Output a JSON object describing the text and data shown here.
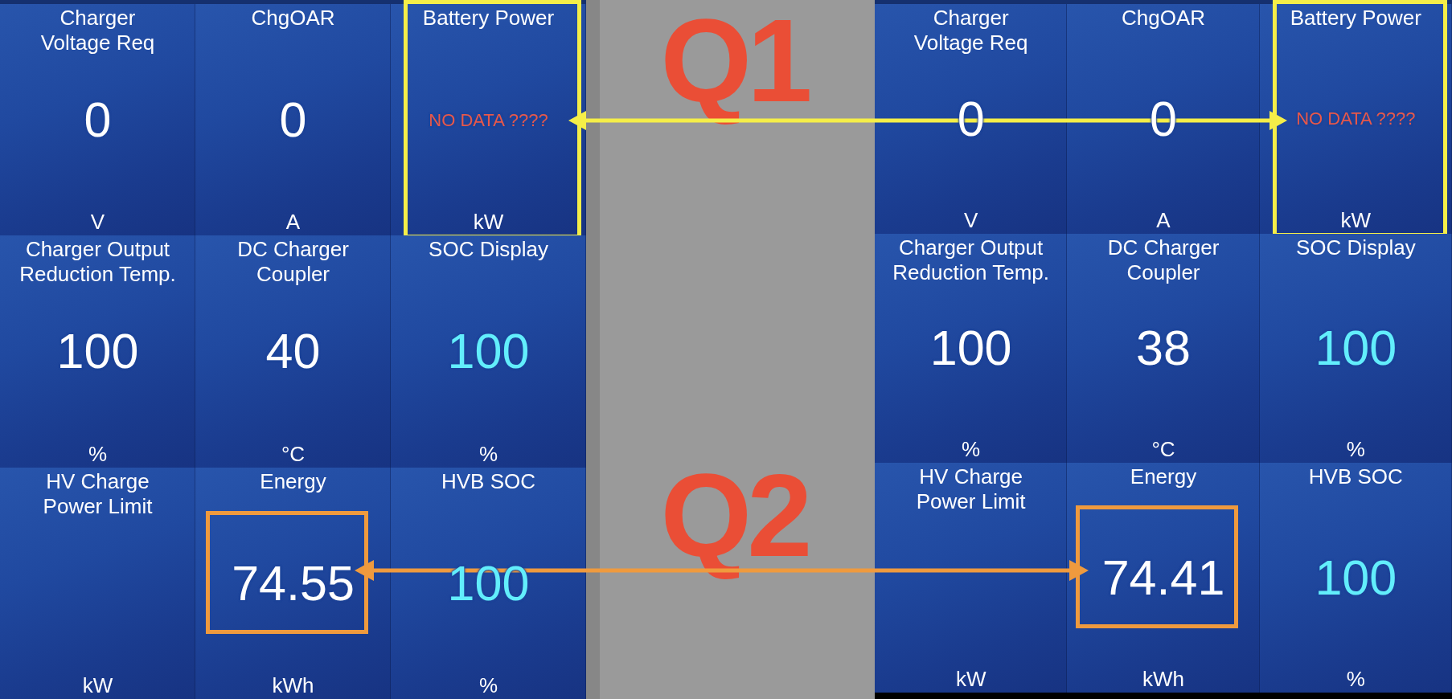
{
  "panels": [
    {
      "tiles": [
        {
          "label": "Charger\nVoltage Req",
          "value": "0",
          "unit": "V",
          "kind": "plain"
        },
        {
          "label": "ChgOAR",
          "value": "0",
          "unit": "A",
          "kind": "plain"
        },
        {
          "label": "Battery Power",
          "value": "NO DATA ????",
          "unit": "kW",
          "kind": "no_data",
          "highlight": {
            "kind": "tile",
            "color": "#f5ee48"
          }
        },
        {
          "label": "Charger Output\nReduction Temp.",
          "value": "100",
          "unit": "%",
          "kind": "plain"
        },
        {
          "label": "DC Charger\nCoupler",
          "value": "40",
          "unit": "°C",
          "kind": "plain"
        },
        {
          "label": "SOC Display",
          "value": "100",
          "unit": "%",
          "kind": "soc"
        },
        {
          "label": "HV Charge\nPower Limit",
          "unit": "kW"
        },
        {
          "label": "Energy",
          "value": "74.55",
          "unit": "kWh",
          "kind": "plain",
          "highlight": {
            "kind": "value",
            "color": "#ef9a3e"
          }
        },
        {
          "label": "HVB SOC",
          "value": "100",
          "unit": "%",
          "kind": "soc"
        }
      ]
    },
    {
      "tiles": [
        {
          "label": "Charger\nVoltage Req",
          "value": "0",
          "unit": "V",
          "kind": "plain"
        },
        {
          "label": "ChgOAR",
          "value": "0",
          "unit": "A",
          "kind": "plain"
        },
        {
          "label": "Battery Power",
          "value": "NO DATA ????",
          "unit": "kW",
          "kind": "no_data",
          "highlight": {
            "kind": "tile",
            "color": "#f5ee48"
          }
        },
        {
          "label": "Charger Output\nReduction Temp.",
          "value": "100",
          "unit": "%",
          "kind": "plain"
        },
        {
          "label": "DC Charger\nCoupler",
          "value": "38",
          "unit": "°C",
          "kind": "plain"
        },
        {
          "label": "SOC Display",
          "value": "100",
          "unit": "%",
          "kind": "soc"
        },
        {
          "label": "HV Charge\nPower Limit",
          "unit": "kW"
        },
        {
          "label": "Energy",
          "value": "74.41",
          "unit": "kWh",
          "kind": "plain",
          "highlight": {
            "kind": "value",
            "color": "#ef9a3e"
          }
        },
        {
          "label": "HVB SOC",
          "value": "100",
          "unit": "%",
          "kind": "soc"
        }
      ]
    }
  ],
  "annotations": [
    {
      "label": "Q1",
      "color": "#f5ee48"
    },
    {
      "label": "Q2",
      "color": "#ef9a3e"
    }
  ]
}
